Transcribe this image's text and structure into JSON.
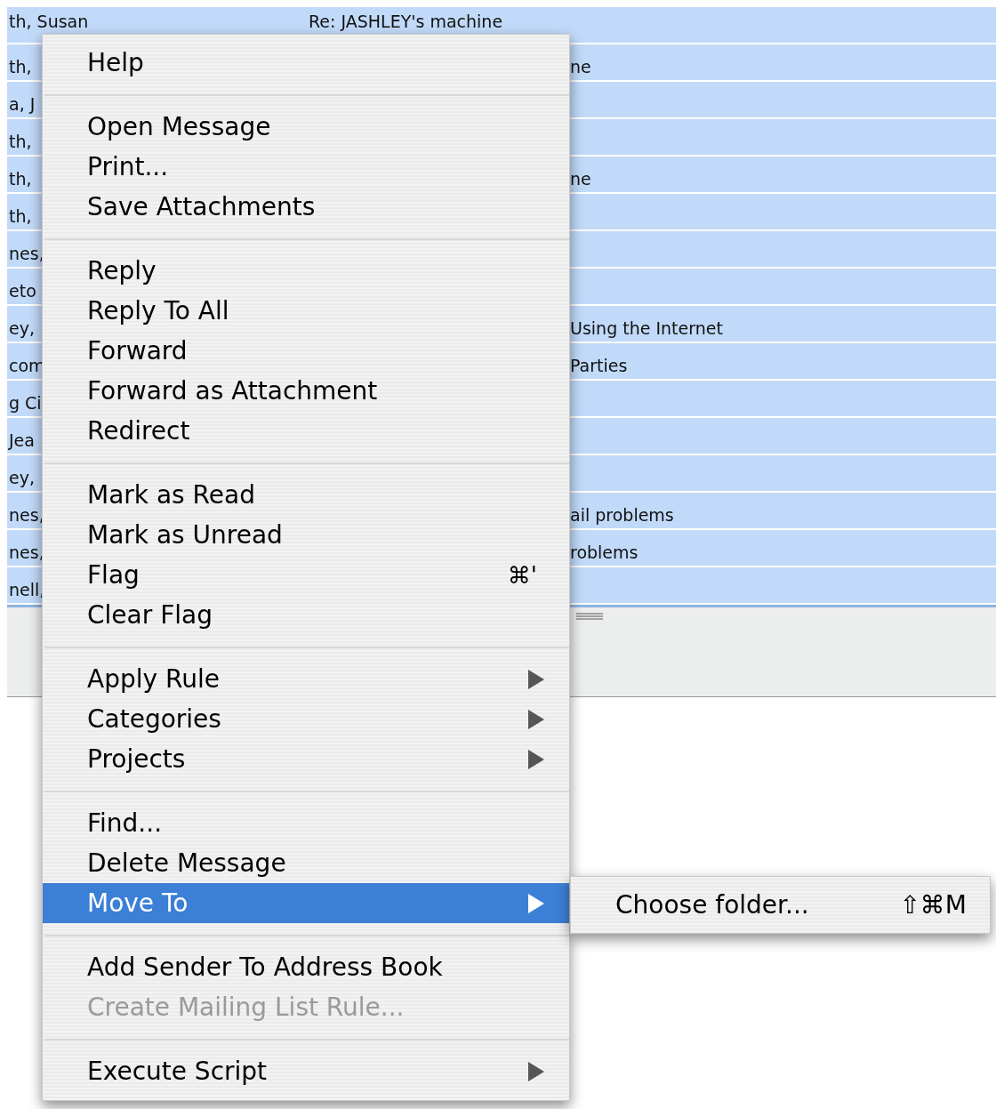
{
  "message_list": {
    "rows": [
      {
        "sender": "th, Susan",
        "subject": "Re: JASHLEY's machine"
      },
      {
        "sender": "th,",
        "subject": "ne"
      },
      {
        "sender": "a, J"
      },
      {
        "sender": "th,"
      },
      {
        "sender": "th,",
        "subject": "ne"
      },
      {
        "sender": "th,"
      },
      {
        "sender": "nes,"
      },
      {
        "sender": "eto"
      },
      {
        "sender": "ey,",
        "subject": "Using the Internet"
      },
      {
        "sender": "com",
        "subject": "Parties"
      },
      {
        "sender": "g Ci"
      },
      {
        "sender": "Jea"
      },
      {
        "sender": "ey,"
      },
      {
        "sender": "nes,",
        "subject": "ail problems"
      },
      {
        "sender": "nes,",
        "subject": "roblems"
      },
      {
        "sender": "nell,"
      }
    ]
  },
  "context_menu": {
    "items": [
      {
        "kind": "item",
        "label": "Help",
        "selected": false,
        "disabled": false,
        "submenu": false
      },
      {
        "kind": "separator"
      },
      {
        "kind": "item",
        "label": "Open Message",
        "selected": false,
        "disabled": false,
        "submenu": false
      },
      {
        "kind": "item",
        "label": "Print...",
        "selected": false,
        "disabled": false,
        "submenu": false
      },
      {
        "kind": "item",
        "label": "Save Attachments",
        "selected": false,
        "disabled": false,
        "submenu": false
      },
      {
        "kind": "separator"
      },
      {
        "kind": "item",
        "label": "Reply",
        "selected": false,
        "disabled": false,
        "submenu": false
      },
      {
        "kind": "item",
        "label": "Reply To All",
        "selected": false,
        "disabled": false,
        "submenu": false
      },
      {
        "kind": "item",
        "label": "Forward",
        "selected": false,
        "disabled": false,
        "submenu": false
      },
      {
        "kind": "item",
        "label": "Forward as Attachment",
        "selected": false,
        "disabled": false,
        "submenu": false
      },
      {
        "kind": "item",
        "label": "Redirect",
        "selected": false,
        "disabled": false,
        "submenu": false
      },
      {
        "kind": "separator"
      },
      {
        "kind": "item",
        "label": "Mark as Read",
        "selected": false,
        "disabled": false,
        "submenu": false
      },
      {
        "kind": "item",
        "label": "Mark as Unread",
        "selected": false,
        "disabled": false,
        "submenu": false
      },
      {
        "kind": "item",
        "label": "Flag",
        "shortcut": "⌘'",
        "selected": false,
        "disabled": false,
        "submenu": false
      },
      {
        "kind": "item",
        "label": "Clear Flag",
        "selected": false,
        "disabled": false,
        "submenu": false
      },
      {
        "kind": "separator"
      },
      {
        "kind": "item",
        "label": "Apply Rule",
        "selected": false,
        "disabled": false,
        "submenu": true
      },
      {
        "kind": "item",
        "label": "Categories",
        "selected": false,
        "disabled": false,
        "submenu": true
      },
      {
        "kind": "item",
        "label": "Projects",
        "selected": false,
        "disabled": false,
        "submenu": true
      },
      {
        "kind": "separator"
      },
      {
        "kind": "item",
        "label": "Find...",
        "selected": false,
        "disabled": false,
        "submenu": false
      },
      {
        "kind": "item",
        "label": "Delete Message",
        "selected": false,
        "disabled": false,
        "submenu": false
      },
      {
        "kind": "item",
        "label": "Move To",
        "selected": true,
        "disabled": false,
        "submenu": true
      },
      {
        "kind": "separator"
      },
      {
        "kind": "item",
        "label": "Add Sender To Address Book",
        "selected": false,
        "disabled": false,
        "submenu": false
      },
      {
        "kind": "item",
        "label": "Create Mailing List Rule...",
        "selected": false,
        "disabled": true,
        "submenu": false
      },
      {
        "kind": "separator"
      },
      {
        "kind": "item",
        "label": "Execute Script",
        "selected": false,
        "disabled": false,
        "submenu": true
      }
    ]
  },
  "submenu": {
    "items": [
      {
        "kind": "item",
        "label": "Choose folder...",
        "shortcut": "⇧⌘M",
        "selected": false,
        "disabled": false,
        "submenu": false
      }
    ]
  }
}
